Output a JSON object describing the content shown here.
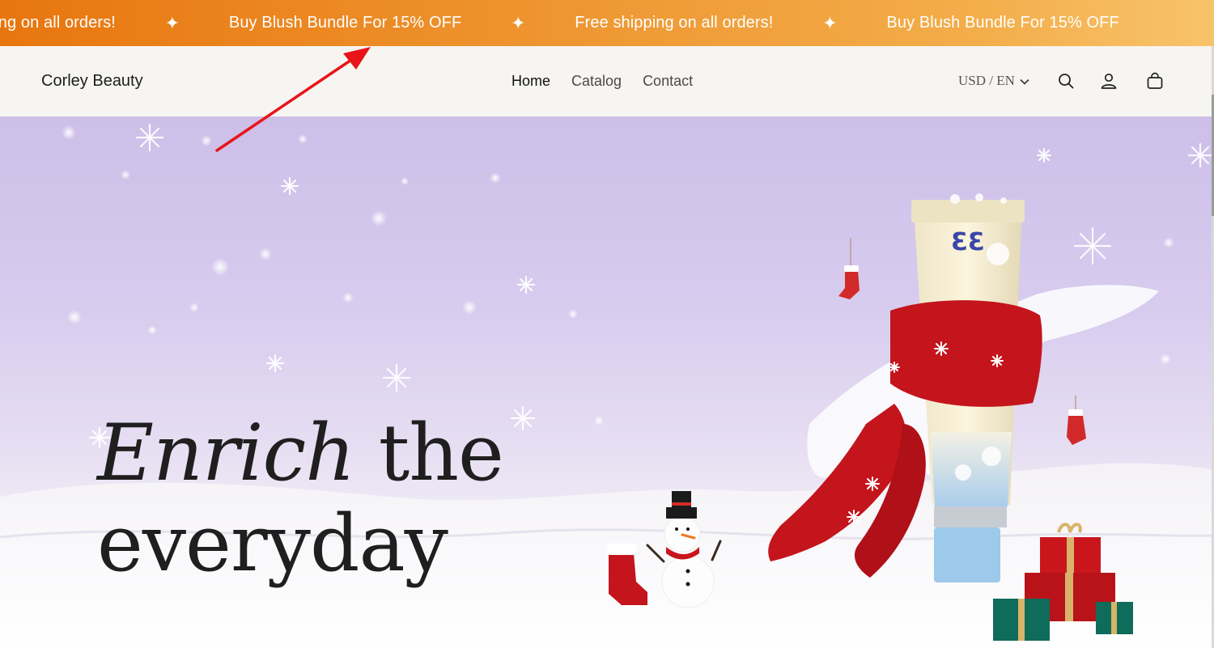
{
  "announcement": {
    "items": [
      "ping on all orders!",
      "Buy Blush Bundle For 15% OFF",
      "Free shipping on all orders!",
      "Buy Blush Bundle For 15% OFF"
    ],
    "separator": "✦",
    "gradient_start": "#e8760f",
    "gradient_end": "#f8c36a"
  },
  "header": {
    "logo": "Corley Beauty",
    "nav": [
      {
        "label": "Home",
        "active": true
      },
      {
        "label": "Catalog",
        "active": false
      },
      {
        "label": "Contact",
        "active": false
      }
    ],
    "localization": "USD / EN",
    "icons": [
      "search-icon",
      "account-icon",
      "cart-icon"
    ]
  },
  "hero": {
    "heading_italic": "Enrich",
    "heading_rest_line1": " the",
    "heading_line2": "everyday",
    "product_logo": "ƐƐ"
  },
  "annotation": {
    "arrow_color": "#e8141a"
  }
}
